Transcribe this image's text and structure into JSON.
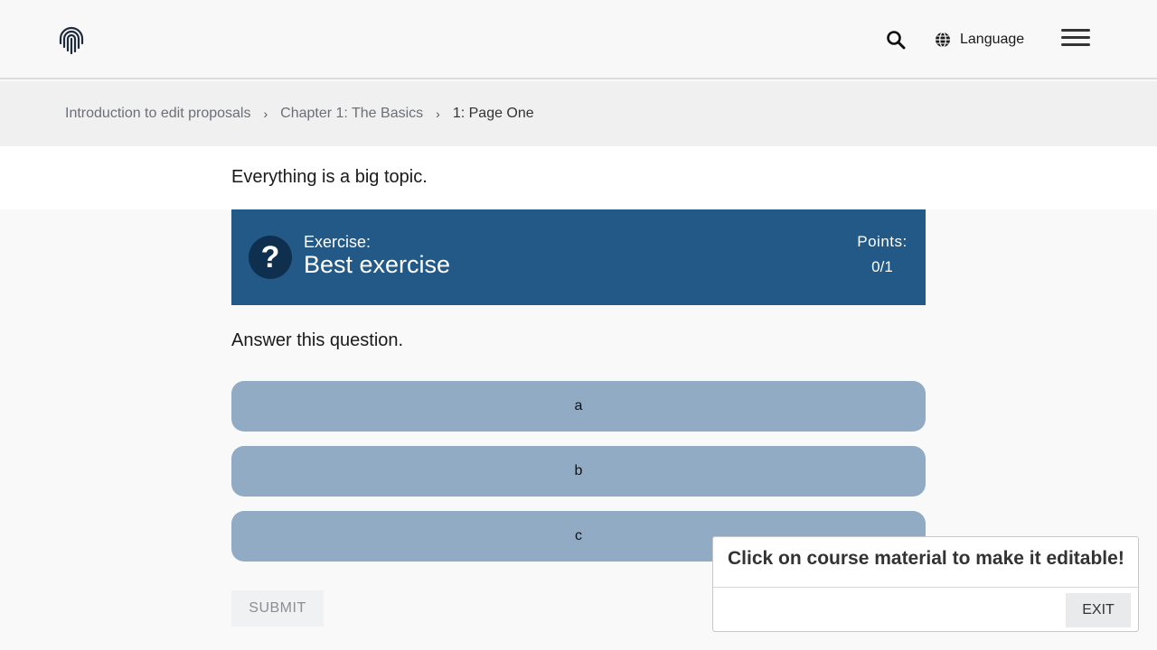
{
  "header": {
    "logo_icon": "fingerprint-icon",
    "search_icon": "search-icon",
    "language_icon": "globe-icon",
    "language_label": "Language",
    "menu_icon": "hamburger-menu-icon"
  },
  "breadcrumb": {
    "items": [
      "Introduction to edit proposals",
      "Chapter 1: The Basics",
      "1: Page One"
    ],
    "separator": "›"
  },
  "content": {
    "intro": "Everything is a big topic.",
    "exercise": {
      "label": "Exercise:",
      "title": "Best exercise",
      "icon": "question-mark-icon",
      "points_label": "Points:",
      "points_value": "0/1"
    },
    "question": "Answer this question.",
    "options": [
      "a",
      "b",
      "c"
    ],
    "submit_label": "SUBMIT"
  },
  "edit_popup": {
    "title": "Click on course material to make it editable!",
    "exit_label": "EXIT"
  },
  "colors": {
    "exercise_header": "#235987",
    "option_bg": "#91abc5",
    "question_circle": "#0f2f4e"
  }
}
